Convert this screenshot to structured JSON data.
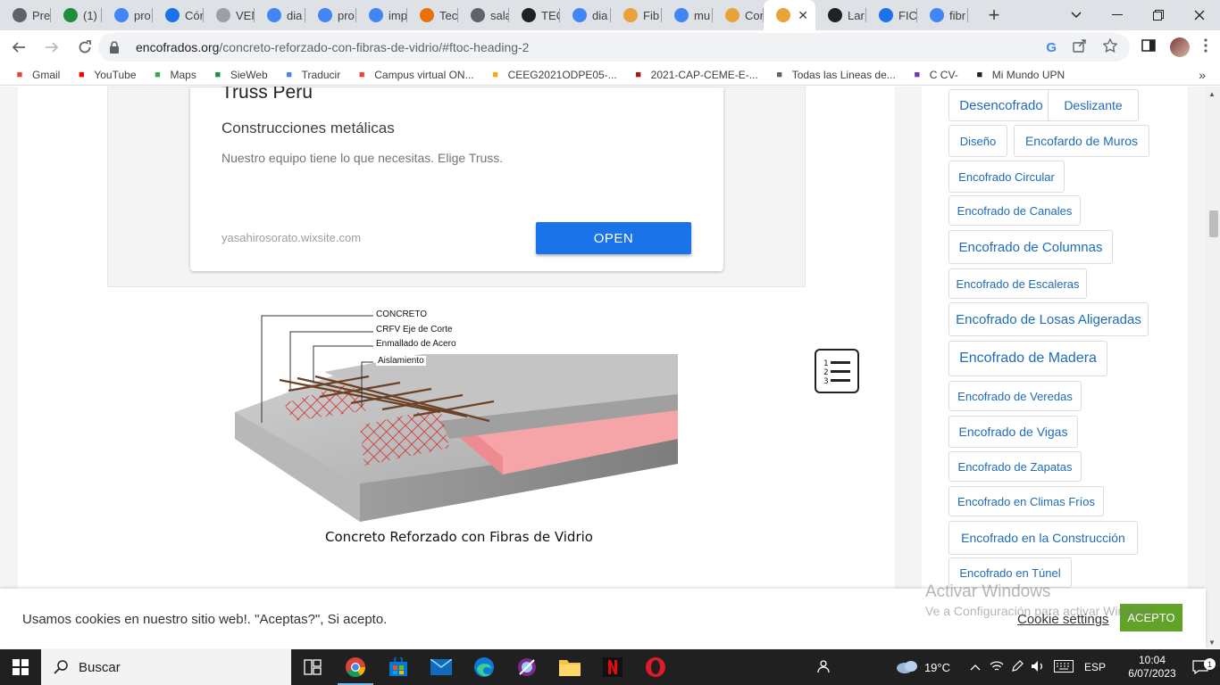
{
  "tabs": [
    {
      "label": "Pre",
      "icon": "globe-icon",
      "color": "#5f6368"
    },
    {
      "label": "(1)",
      "icon": "badge-icon",
      "color": "#1e8e3e"
    },
    {
      "label": "pro",
      "icon": "google-icon",
      "color": "#4285f4"
    },
    {
      "label": "Cór",
      "icon": "site-icon",
      "color": "#1a73e8"
    },
    {
      "label": "VEN",
      "icon": "site-icon",
      "color": "#9aa0a6"
    },
    {
      "label": "dia",
      "icon": "google-icon",
      "color": "#4285f4"
    },
    {
      "label": "pro",
      "icon": "google-icon",
      "color": "#4285f4"
    },
    {
      "label": "imp",
      "icon": "google-icon",
      "color": "#4285f4"
    },
    {
      "label": "Tec",
      "icon": "site-icon",
      "color": "#e8710a"
    },
    {
      "label": "sala",
      "icon": "globe-icon",
      "color": "#5f6368"
    },
    {
      "label": "TEC",
      "icon": "wave-icon",
      "color": "#202124"
    },
    {
      "label": "dia",
      "icon": "google-icon",
      "color": "#4285f4"
    },
    {
      "label": "Fib",
      "icon": "site-icon",
      "color": "#e8a33b"
    },
    {
      "label": "mu",
      "icon": "google-icon",
      "color": "#4285f4"
    },
    {
      "label": "Cor",
      "icon": "site-icon",
      "color": "#e8a33b"
    },
    {
      "label": "",
      "icon": "site-icon",
      "color": "#e8a33b",
      "active": true
    },
    {
      "label": "Lar",
      "icon": "site-icon",
      "color": "#202124"
    },
    {
      "label": "FIC",
      "icon": "site-icon",
      "color": "#1a73e8"
    },
    {
      "label": "fibr",
      "icon": "google-icon",
      "color": "#4285f4"
    }
  ],
  "address": {
    "host": "encofrados.org",
    "path": "/concreto-reforzado-con-fibras-de-vidrio/#ftoc-heading-2"
  },
  "bookmarks": [
    {
      "label": "Gmail",
      "icon": "gmail-icon",
      "color": "#ea4335"
    },
    {
      "label": "YouTube",
      "icon": "youtube-icon",
      "color": "#ff0000"
    },
    {
      "label": "Maps",
      "icon": "maps-icon",
      "color": "#34a853"
    },
    {
      "label": "SieWeb",
      "icon": "sieweb-icon",
      "color": "#1e8e3e"
    },
    {
      "label": "Traducir",
      "icon": "translate-icon",
      "color": "#4285f4"
    },
    {
      "label": "Campus virtual ON...",
      "icon": "gmail-icon",
      "color": "#ea4335"
    },
    {
      "label": "CEEG2021ODPE05-...",
      "icon": "folder-icon",
      "color": "#f9ab00"
    },
    {
      "label": "2021-CAP-CEME-E-...",
      "icon": "site-icon",
      "color": "#b31412"
    },
    {
      "label": "Todas las Lineas de...",
      "icon": "globe-icon",
      "color": "#5f6368"
    },
    {
      "label": "C CV-",
      "icon": "site-icon",
      "color": "#673ab7"
    },
    {
      "label": "Mi Mundo UPN",
      "icon": "arrow-up-icon",
      "color": "#202124"
    }
  ],
  "ad": {
    "title": "Truss Perú",
    "headline": "Construcciones metálicas",
    "description": "Nuestro equipo tiene lo que necesitas. Elige Truss.",
    "url": "yasahirosorato.wixsite.com",
    "button": "OPEN"
  },
  "figure": {
    "labels": [
      "CONCRETO",
      "CRFV Eje de Corte",
      "Enmallado de Acero",
      "Aislamiento"
    ],
    "caption": "Concreto Reforzado con Fibras de Vidrio"
  },
  "tags": [
    {
      "label": "Desencofrado",
      "size": "lg"
    },
    {
      "label": "Deslizante",
      "size": "md"
    },
    {
      "label": "Diseño",
      "size": "sm"
    },
    {
      "label": "Encofardo de Muros",
      "size": "md"
    },
    {
      "label": "Encofrado Circular",
      "size": "sm"
    },
    {
      "label": "Encofrado de Canales",
      "size": "sm"
    },
    {
      "label": "Encofrado de Columnas",
      "size": "lg"
    },
    {
      "label": "Encofrado de Escaleras",
      "size": "sm"
    },
    {
      "label": "Encofrado de Losas Aligeradas",
      "size": "lg"
    },
    {
      "label": "Encofrado de Madera",
      "size": "xl"
    },
    {
      "label": "Encofrado de Veredas",
      "size": "sm"
    },
    {
      "label": "Encofrado de Vigas",
      "size": "md"
    },
    {
      "label": "Encofrado de Zapatas",
      "size": "sm"
    },
    {
      "label": "Encofrado en Climas Fríos",
      "size": "sm"
    },
    {
      "label": "Encofrado en la Construcción",
      "size": "md"
    },
    {
      "label": "Encofrado en Túnel",
      "size": "sm"
    }
  ],
  "cookie": {
    "text": "Usamos cookies en nuestro sitio web!. \"Aceptas?\", Si acepto.",
    "settings": "Cookie settings",
    "accept": "ACEPTO"
  },
  "watermark": {
    "line1": "Activar Windows",
    "line2": "Ve a Configuración para activar Windows."
  },
  "taskbar": {
    "search": "Buscar",
    "temp": "19°C",
    "lang": "ESP",
    "time": "10:04",
    "date": "6/07/2023",
    "notifications": "1"
  }
}
